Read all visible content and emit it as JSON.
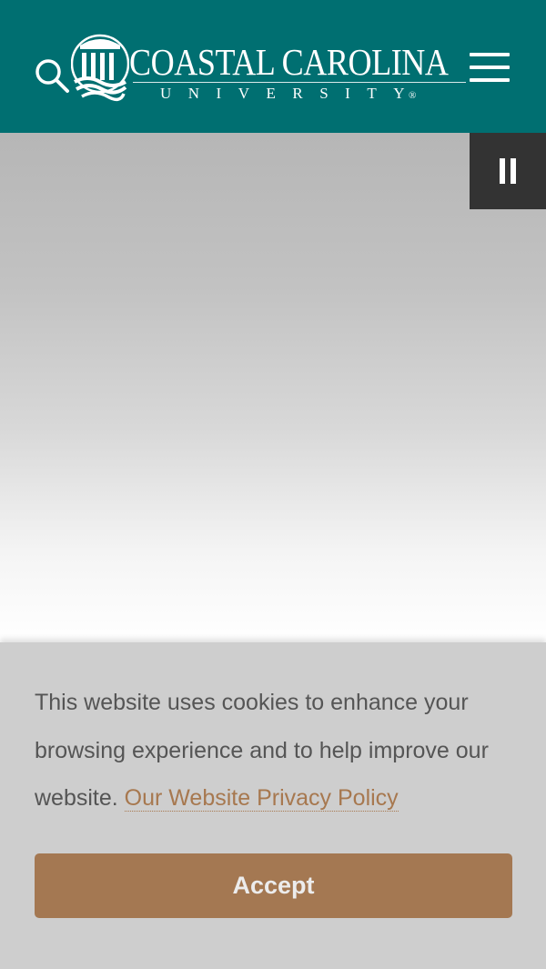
{
  "header": {
    "background": "#006f71",
    "logo": {
      "name": "COASTAL CAROLINA",
      "sub": "UNIVERSITY",
      "registered": "®"
    },
    "search_icon": "search-icon",
    "menu_icon": "hamburger-menu-icon"
  },
  "hero": {
    "pause_icon": "pause-icon"
  },
  "cookie_banner": {
    "message": "This website uses cookies to enhance your browsing experience and to help improve our website.",
    "policy_link": "Our Website Privacy Policy",
    "accept_label": "Accept",
    "accent": "#a47852"
  }
}
